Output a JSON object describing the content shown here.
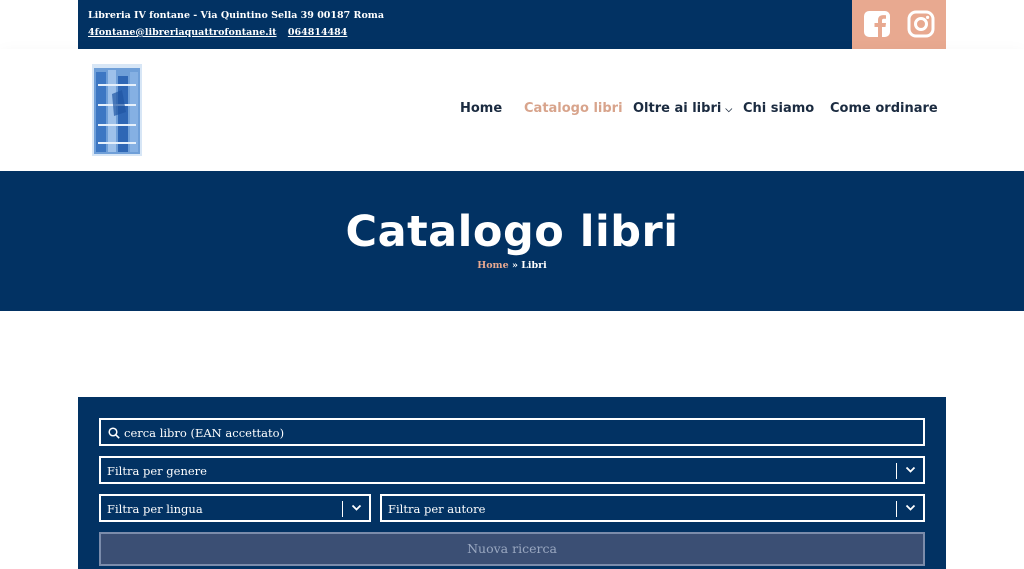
{
  "topbar": {
    "address": "Libreria IV fontane - Via Quintino Sella 39 00187 Roma",
    "email": "4fontane@libreriaquattrofontane.it",
    "phone": "064814484",
    "social": [
      "facebook-icon",
      "instagram-icon"
    ]
  },
  "nav": {
    "items": [
      {
        "label": "Home"
      },
      {
        "label": "Catalogo libri",
        "active": true
      },
      {
        "label": "Oltre ai libri",
        "has_dropdown": true
      },
      {
        "label": "Chi siamo"
      },
      {
        "label": "Come ordinare"
      }
    ],
    "dropdown_chevron": "⌵"
  },
  "hero": {
    "title": "Catalogo libri",
    "breadcrumb": {
      "home": "Home",
      "separator": "»",
      "current": "Libri"
    }
  },
  "search": {
    "placeholder": "cerca libro (EAN accettato)",
    "filters": {
      "genere": "Filtra per genere",
      "lingua": "Filtra per lingua",
      "autore": "Filtra per autore"
    },
    "submit_label": "Nuova ricerca"
  },
  "colors": {
    "navy": "#023263",
    "accent": "#e8a990",
    "active_nav": "#d8a48c"
  }
}
